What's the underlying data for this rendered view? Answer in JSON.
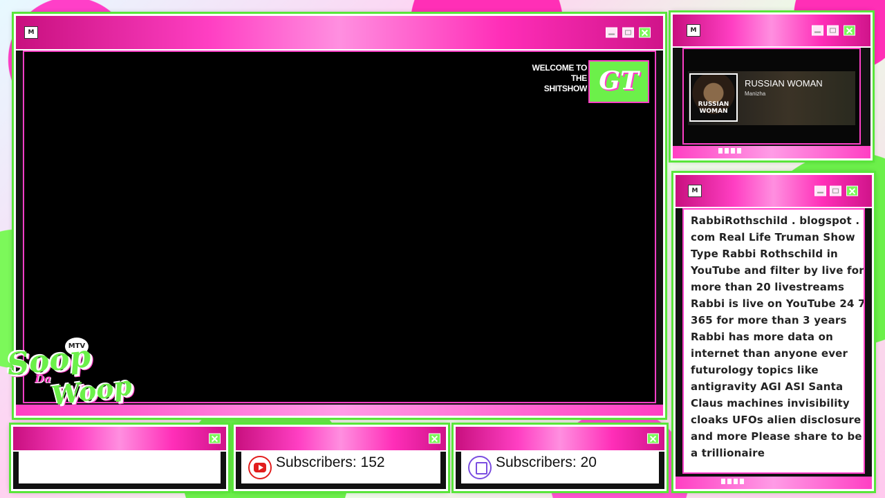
{
  "main": {
    "title_icon": "mtv-icon",
    "welcome_lines": [
      "WELCOME TO",
      "THE",
      "SHITSHOW"
    ],
    "logo_text": "GT"
  },
  "music": {
    "title_icon": "mtv-icon",
    "song_title": "RUSSIAN WOMAN",
    "artist": "Manizha",
    "cover_text": "RUSSIAN WOMAN"
  },
  "info": {
    "title_icon": "mtv-icon",
    "text": "RabbiRothschild . blogspot .\ncom Real Life Truman Show\nType Rabbi Rothschild in\nYouTube and filter by live for\nmore than 20 livestreams\nRabbi is live on YouTube 24 7\n365 for more than 3 years\nRabbi has more data on\ninternet than anyone ever\nfuturology topics like\nantigravity AGI ASI Santa\nClaus machines invisibility\ncloaks UFOs alien disclosure\nand more Please share to be\na trillionaire"
  },
  "bottom": {
    "youtube_subscribers": "Subscribers: 152",
    "twitch_subscribers": "Subscribers: 20"
  },
  "logo": {
    "word1": "Soop",
    "word2": "Da",
    "word3": "Woop",
    "badge": "MTV"
  },
  "colors": {
    "accent_pink": "#ff3fc8",
    "accent_green": "#6cf04a",
    "youtube_red": "#e21d1d",
    "twitch_purple": "#7a4de0"
  }
}
